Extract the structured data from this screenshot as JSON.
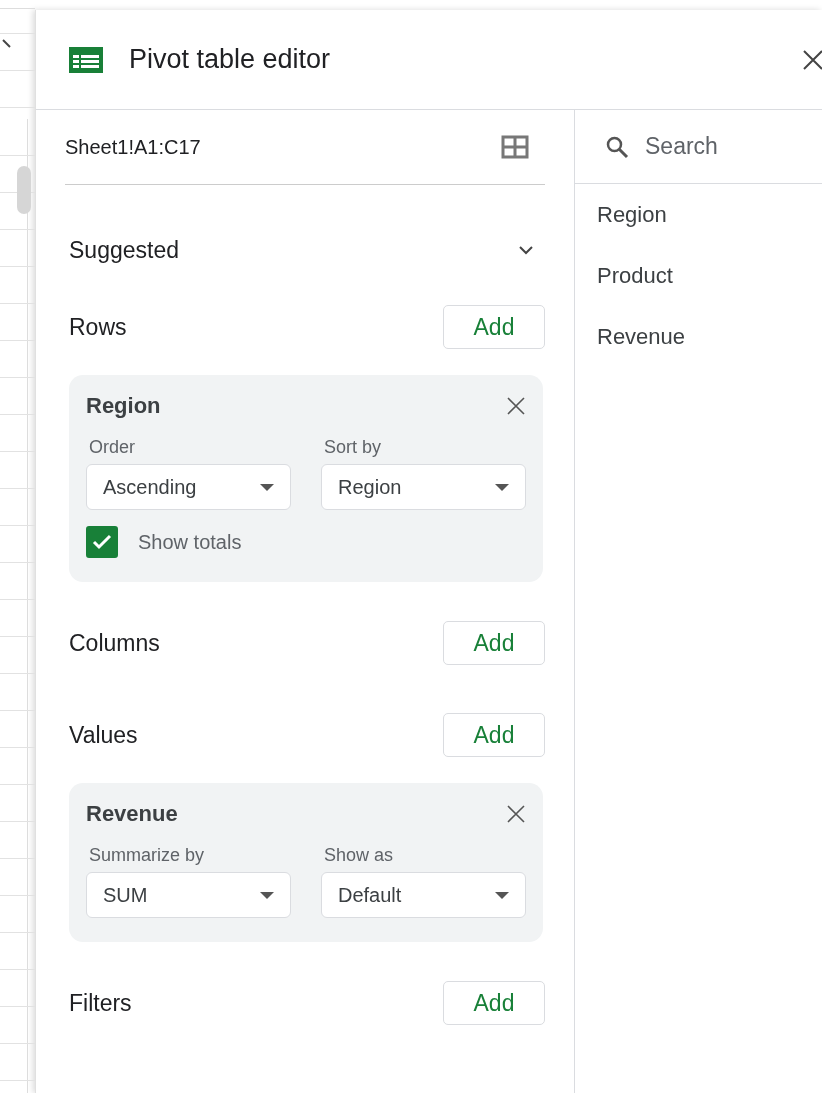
{
  "panel": {
    "title": "Pivot table editor"
  },
  "source_range": {
    "value": "Sheet1!A1:C17"
  },
  "suggested": {
    "label": "Suggested"
  },
  "sections": [
    {
      "label": "Rows",
      "button": "Add",
      "cards": [
        {
          "title": "Region",
          "fields": [
            {
              "label": "Order",
              "value": "Ascending"
            },
            {
              "label": "Sort by",
              "value": "Region"
            }
          ],
          "checkbox": {
            "label": "Show totals",
            "checked": true
          }
        }
      ]
    },
    {
      "label": "Columns",
      "button": "Add"
    },
    {
      "label": "Values",
      "button": "Add",
      "cards": [
        {
          "title": "Revenue",
          "fields": [
            {
              "label": "Summarize by",
              "value": "SUM"
            },
            {
              "label": "Show as",
              "value": "Default"
            }
          ]
        }
      ]
    },
    {
      "label": "Filters",
      "button": "Add"
    }
  ],
  "field_search": {
    "placeholder": "Search"
  },
  "fields": [
    "Region",
    "Product",
    "Revenue"
  ]
}
